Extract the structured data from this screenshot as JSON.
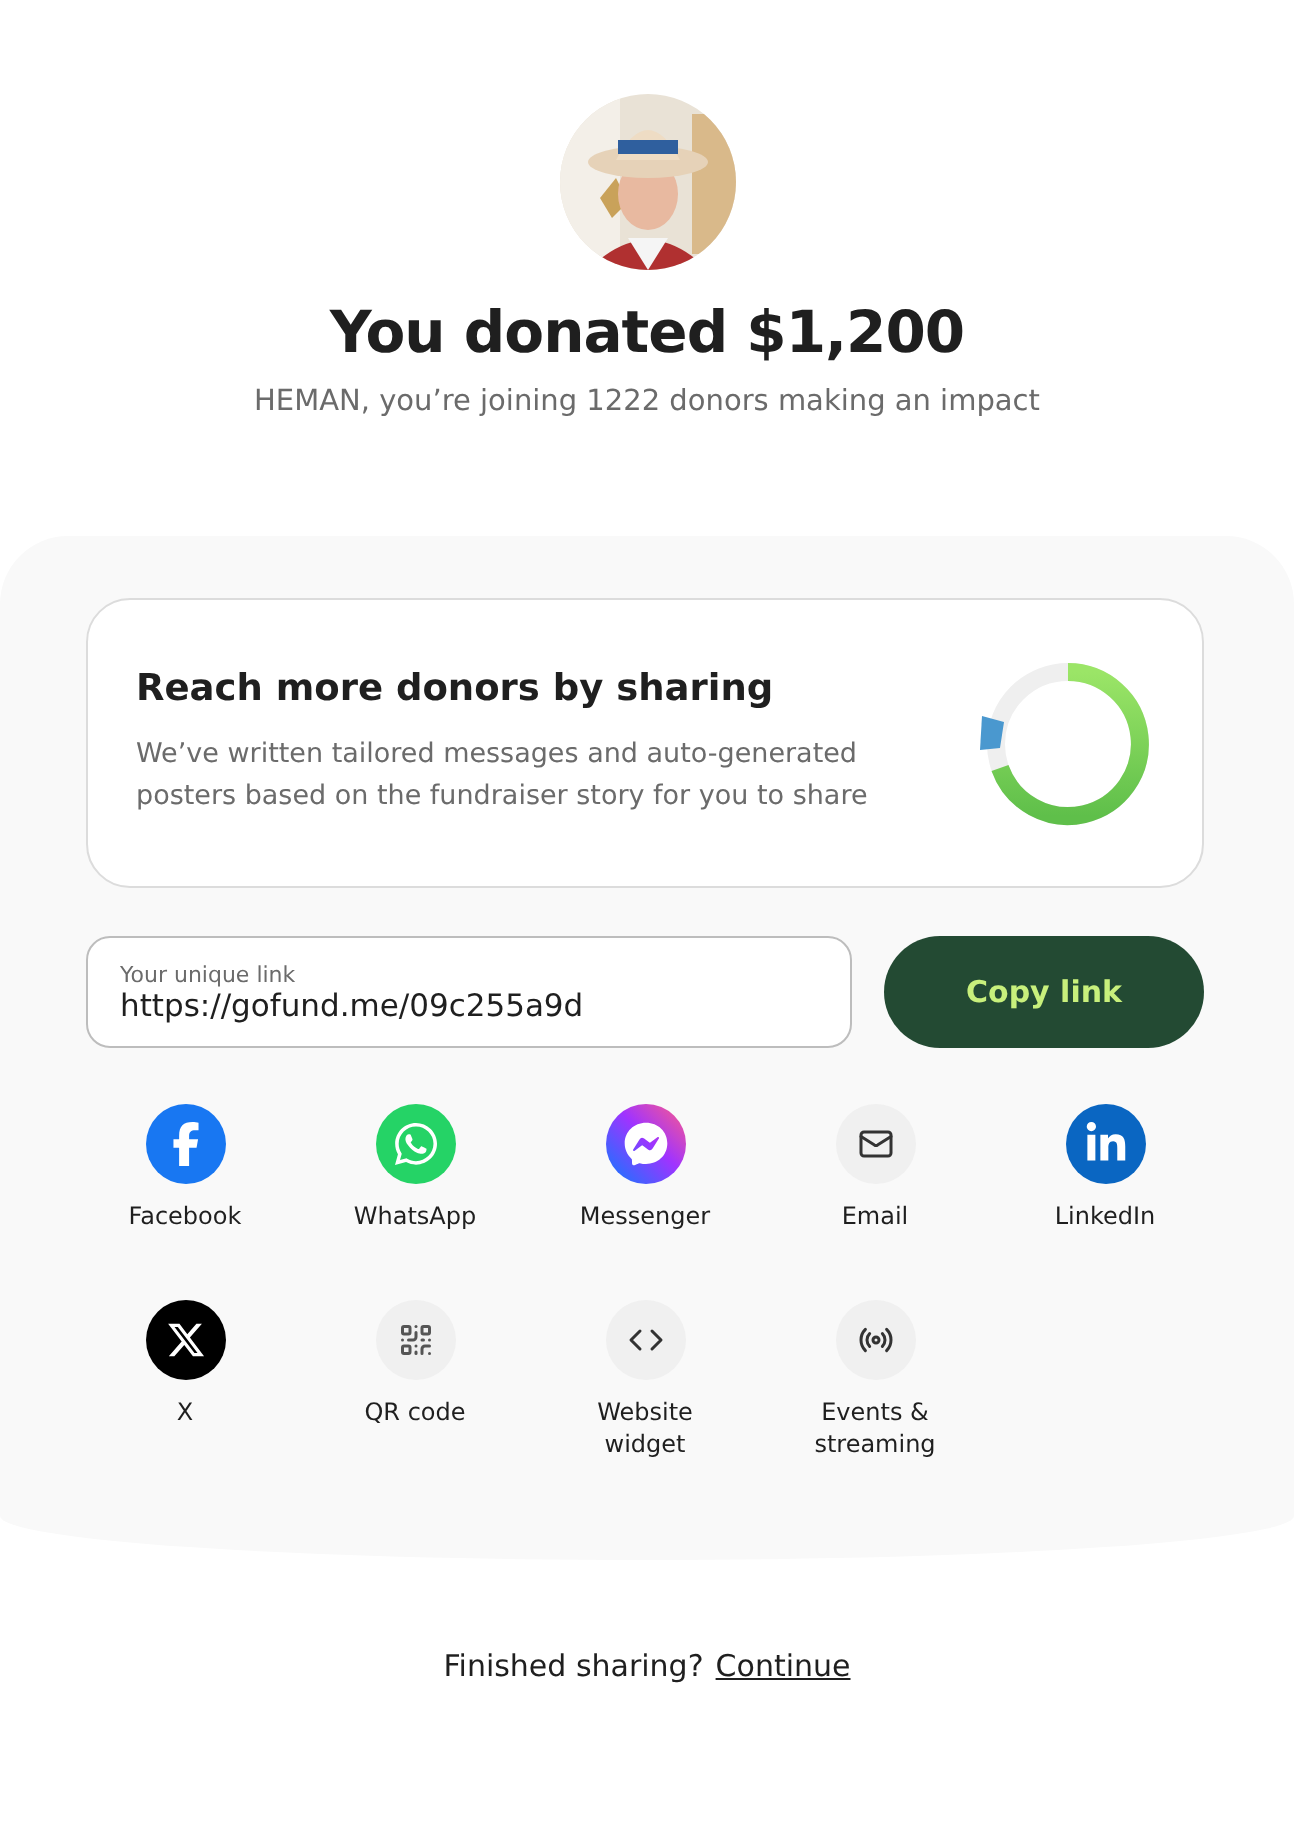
{
  "header": {
    "title": "You donated $1,200",
    "subtitle": "HEMAN, you’re joining 1222 donors making an impact"
  },
  "share_card": {
    "title": "Reach more donors by sharing",
    "description": "We’ve written tailored messages and auto-generated posters based on the fundraiser story for you to share"
  },
  "link_field": {
    "label": "Your unique link",
    "value": "https://gofund.me/09c255a9d"
  },
  "copy_button": "Copy link",
  "share_options": [
    {
      "kind": "facebook",
      "label": "Facebook"
    },
    {
      "kind": "whatsapp",
      "label": "WhatsApp"
    },
    {
      "kind": "messenger",
      "label": "Messenger"
    },
    {
      "kind": "email",
      "label": "Email"
    },
    {
      "kind": "linkedin",
      "label": "LinkedIn"
    },
    {
      "kind": "x",
      "label": "X"
    },
    {
      "kind": "qr",
      "label": "QR code"
    },
    {
      "kind": "widget",
      "label": "Website widget"
    },
    {
      "kind": "events",
      "label": "Events & streaming"
    }
  ],
  "footer": {
    "prompt": "Finished sharing?",
    "link": "Continue"
  }
}
